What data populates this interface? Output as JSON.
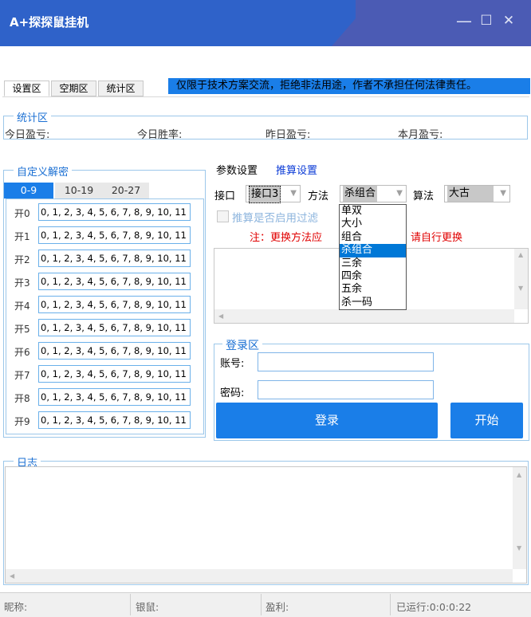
{
  "window": {
    "title": "A+探探鼠挂机",
    "minimize": "—",
    "maximize": "☐",
    "close": "✕"
  },
  "tabs": [
    {
      "label": "设置区",
      "active": true
    },
    {
      "label": "空期区",
      "active": false
    },
    {
      "label": "统计区",
      "active": false
    }
  ],
  "notice": "仅限于技术方案交流，拒绝非法用途，作者不承担任何法律责任。",
  "stats": {
    "title": "统计区",
    "today_profit": "今日盈亏:",
    "today_winrate": "今日胜率:",
    "yesterday_profit": "昨日盈亏:",
    "month_profit": "本月盈亏:"
  },
  "custom_decode": {
    "title": "自定义解密",
    "tabs": [
      {
        "label": "0-9",
        "active": true
      },
      {
        "label": "10-19",
        "active": false
      },
      {
        "label": "20-27",
        "active": false
      }
    ],
    "rows": [
      {
        "label": "开0",
        "value": "0, 1, 2, 3, 4, 5, 6, 7, 8, 9, 10, 11"
      },
      {
        "label": "开1",
        "value": "0, 1, 2, 3, 4, 5, 6, 7, 8, 9, 10, 11"
      },
      {
        "label": "开2",
        "value": "0, 1, 2, 3, 4, 5, 6, 7, 8, 9, 10, 11"
      },
      {
        "label": "开3",
        "value": "0, 1, 2, 3, 4, 5, 6, 7, 8, 9, 10, 11"
      },
      {
        "label": "开4",
        "value": "0, 1, 2, 3, 4, 5, 6, 7, 8, 9, 10, 11"
      },
      {
        "label": "开5",
        "value": "0, 1, 2, 3, 4, 5, 6, 7, 8, 9, 10, 11"
      },
      {
        "label": "开6",
        "value": "0, 1, 2, 3, 4, 5, 6, 7, 8, 9, 10, 11"
      },
      {
        "label": "开7",
        "value": "0, 1, 2, 3, 4, 5, 6, 7, 8, 9, 10, 11"
      },
      {
        "label": "开8",
        "value": "0, 1, 2, 3, 4, 5, 6, 7, 8, 9, 10, 11"
      },
      {
        "label": "开9",
        "value": "0, 1, 2, 3, 4, 5, 6, 7, 8, 9, 10, 11"
      }
    ]
  },
  "params": {
    "tab_param": "参数设置",
    "tab_calc": "推算设置",
    "interface_label": "接口",
    "interface_value": "接口3",
    "method_label": "方法",
    "method_value": "杀组合",
    "algo_label": "算法",
    "algo_value": "大古",
    "filter_label": "推算是否启用过滤",
    "note_left": "注：更换方法应",
    "note_right": "请自行更换",
    "method_options": [
      "单双",
      "大小",
      "组合",
      "杀组合",
      "三余",
      "四余",
      "五余",
      "杀一码"
    ],
    "method_selected_index": 3
  },
  "login": {
    "title": "登录区",
    "account_label": "账号:",
    "password_label": "密码:",
    "account_value": "",
    "password_value": "",
    "login_button": "登录",
    "start_button": "开始"
  },
  "log": {
    "title": "日志"
  },
  "statusbar": {
    "nickname": "昵称:",
    "silver": "银鼠:",
    "profit": "盈利:",
    "runtime": "已运行:0:0:0:22"
  },
  "colors": {
    "titlebar": "#2f62c9",
    "accent": "#1a7ee8",
    "warning": "#e00000"
  }
}
